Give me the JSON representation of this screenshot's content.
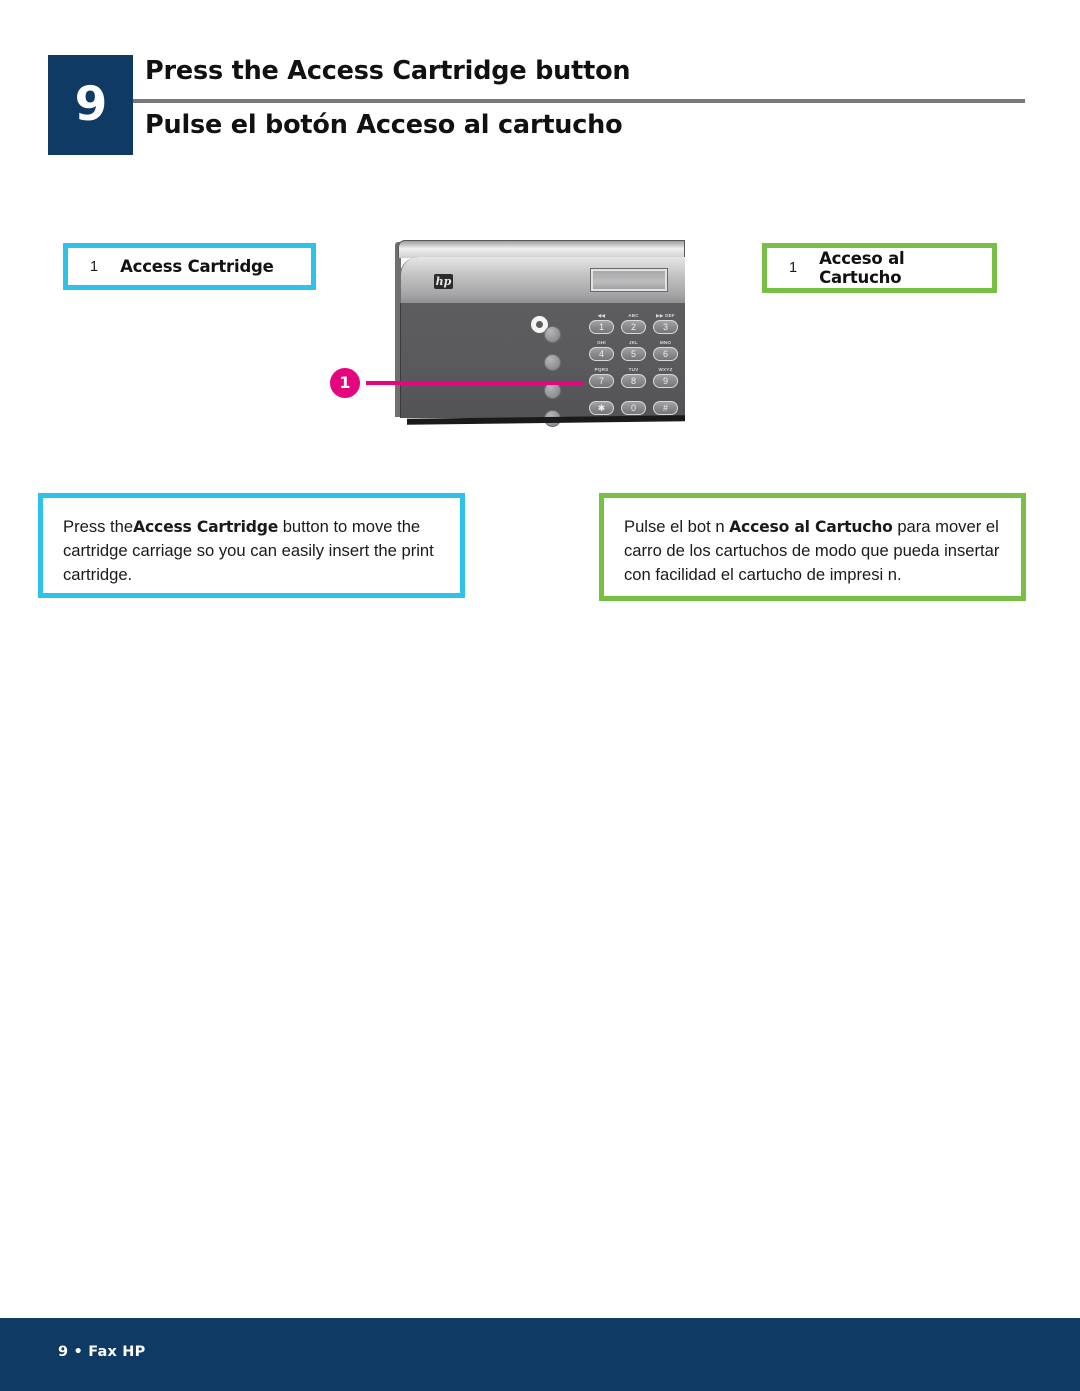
{
  "page": {
    "step_number": "9",
    "title_en": "Press the Access Cartridge button",
    "title_es": "Pulse el botón Acceso al cartucho",
    "background_color": "#ffffff"
  },
  "colors": {
    "navy": "#0e3a63",
    "cyan": "#2ec2e8",
    "green": "#79bf45",
    "magenta": "#e5057f",
    "rule_gray": "#77777c"
  },
  "callouts": {
    "english": {
      "number": "1",
      "label": "Access Cartridge",
      "border_color": "#2ec2e8"
    },
    "spanish": {
      "number": "1",
      "label": "Acceso al Cartucho",
      "border_color": "#79bf45"
    }
  },
  "descriptions": {
    "english": {
      "before": "Press the",
      "bold": "Access Cartridge",
      "after": " button to move the cartridge carriage so you can easily insert the print cartridge.",
      "border_color": "#2ec2e8"
    },
    "spanish": {
      "before": "Pulse el bot n ",
      "bold": "Acceso al Cartucho",
      "after": " para mover el carro de los cartuchos de modo que pueda insertar con facilidad el cartucho de impresi n.",
      "border_color": "#79bf45"
    }
  },
  "figure": {
    "marker_number": "1",
    "brand_logo": "hp",
    "display": "lcd-screen",
    "function_buttons": [
      "fn-button-1",
      "fn-button-2",
      "fn-button-3",
      "fn-button-4"
    ],
    "power_indicator": "power-ring-icon",
    "keypad": [
      {
        "digit": "1",
        "letters": "◀◀"
      },
      {
        "digit": "2",
        "letters": "ABC"
      },
      {
        "digit": "3",
        "letters": "▶▶ DEF"
      },
      {
        "digit": "4",
        "letters": "GHI"
      },
      {
        "digit": "5",
        "letters": "JKL"
      },
      {
        "digit": "6",
        "letters": "MNO"
      },
      {
        "digit": "7",
        "letters": "PQRS"
      },
      {
        "digit": "8",
        "letters": "TUV"
      },
      {
        "digit": "9",
        "letters": "WXYZ"
      },
      {
        "digit": "✱",
        "letters": ""
      },
      {
        "digit": "0",
        "letters": ""
      },
      {
        "digit": "#",
        "letters": ""
      }
    ]
  },
  "footer": {
    "text": "9 • Fax HP",
    "background_color": "#0e3a63"
  }
}
